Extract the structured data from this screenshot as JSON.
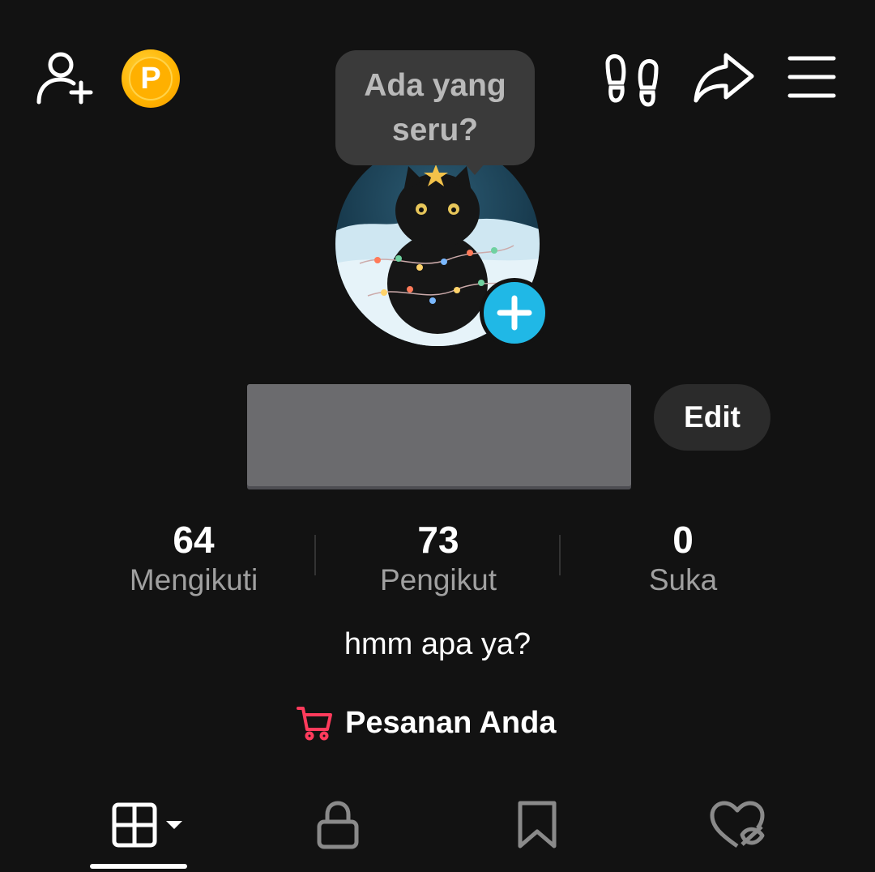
{
  "header": {
    "add_friend_icon": "person-plus-icon",
    "coin_icon": "p-coin-icon",
    "coin_letter": "P",
    "footprint_icon": "footprints-icon",
    "share_icon": "share-arrow-icon",
    "menu_icon": "hamburger-menu-icon"
  },
  "status_bubble": {
    "text": "Ada yang seru?"
  },
  "profile": {
    "edit_label": "Edit",
    "add_badge_icon": "plus-icon",
    "bio": "hmm apa ya?"
  },
  "stats": [
    {
      "value": "64",
      "label": "Mengikuti"
    },
    {
      "value": "73",
      "label": "Pengikut"
    },
    {
      "value": "0",
      "label": "Suka"
    }
  ],
  "orders": {
    "label": "Pesanan Anda",
    "icon": "cart-icon",
    "icon_color": "#ff3b5c"
  },
  "tabs": [
    {
      "icon": "grid-icon",
      "active": true
    },
    {
      "icon": "lock-icon",
      "active": false
    },
    {
      "icon": "bookmark-icon",
      "active": false
    },
    {
      "icon": "heart-hidden-icon",
      "active": false
    }
  ],
  "colors": {
    "background": "#121212",
    "accent_blue": "#20b8e6",
    "coin": "#ffb300",
    "muted_text": "#a0a0a0"
  }
}
